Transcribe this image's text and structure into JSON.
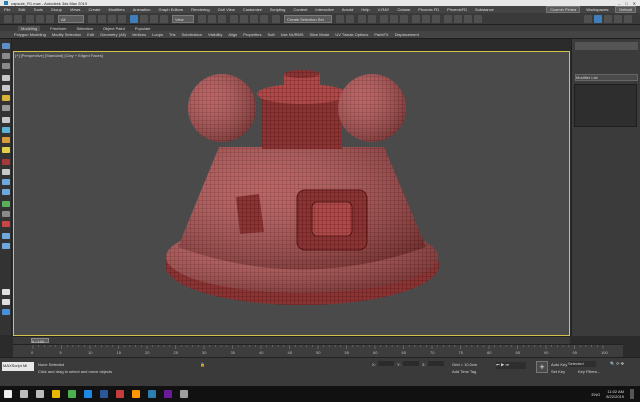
{
  "titlebar": {
    "title": "capsule_R1.max - Autodesk 3ds Max 2019"
  },
  "menu": {
    "items": [
      "File",
      "Edit",
      "Tools",
      "Group",
      "Views",
      "Create",
      "Modifiers",
      "Animation",
      "Graph Editors",
      "Rendering",
      "Civil View",
      "Customize",
      "Scripting",
      "Content",
      "Interactive",
      "Arnold",
      "Help",
      "V-RAY",
      "Octane",
      "Phoenix FD",
      "PhoenixFD",
      "Substance"
    ],
    "user": "Cosmin Pintea",
    "workspaces_label": "Workspaces:",
    "workspace": "Default"
  },
  "toolbar": {
    "filter": "All",
    "view": "View",
    "selection_set": "Create Selection Set"
  },
  "ribbon_tabs": [
    "Modeling",
    "Freeform",
    "Selection",
    "Object Paint",
    "Populate"
  ],
  "ribbon_items": [
    "Polygon Modeling",
    "Modify Selection",
    "Edit",
    "Geometry (All)",
    "Vertices",
    "Loops",
    "Tris",
    "Subdivision",
    "Visibility",
    "Align",
    "Properties",
    "Soft",
    "Use NURMS",
    "Slice Mode",
    "UV Tweak Options",
    "PaintFX",
    "Displacement"
  ],
  "viewport": {
    "label": "[+] [Perspective] [Standard] [Clay + Edged Faces]"
  },
  "command_panel": {
    "modifier_list": "Modifier List"
  },
  "timeline": {
    "frame": "0 / 100",
    "ticks": [
      "0",
      "5",
      "10",
      "15",
      "20",
      "25",
      "30",
      "35",
      "40",
      "45",
      "50",
      "55",
      "60",
      "65",
      "70",
      "75",
      "80",
      "85",
      "90",
      "95",
      "100"
    ]
  },
  "status": {
    "maxscript": "MAXScript Mi",
    "none_selected": "None Selected",
    "prompt": "Click and drag to select and move objects",
    "x_label": "X:",
    "y_label": "Y:",
    "z_label": "Z:",
    "grid": "Grid = 10.0cm",
    "add_time_tag": "Add Time Tag",
    "autokey": "Auto Key",
    "selected": "Selected",
    "set_key": "Set Key",
    "key_filters": "Key Filters..."
  },
  "taskbar": {
    "lang": "ENG",
    "time": "11:02 AM",
    "date": "8/22/2019"
  },
  "colors": {
    "mesh": "#b04a4a",
    "wire": "#5a1414",
    "viewport_bg": "#4a4a4a",
    "active_border": "#d4c14a",
    "accent": "#3f7dbd"
  }
}
